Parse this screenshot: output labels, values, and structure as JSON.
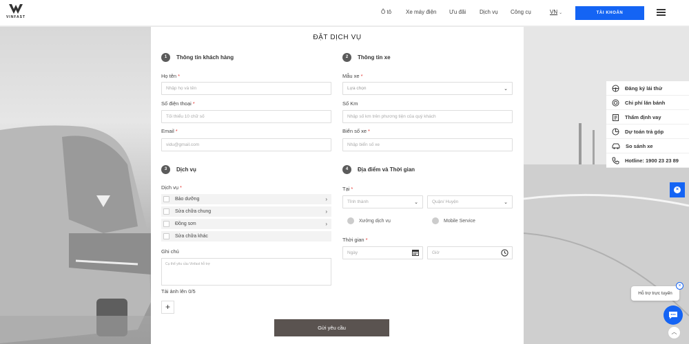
{
  "header": {
    "logo_text": "VINFAST",
    "nav": [
      "Ô tô",
      "Xe máy điện",
      "Ưu đãi",
      "Dịch vụ",
      "Công cụ"
    ],
    "lang": "VN",
    "account_label": "TÀI KHOẢN"
  },
  "form": {
    "title": "ĐẶT DỊCH VỤ",
    "customer": {
      "num": "1",
      "heading": "Thông tin khách hàng",
      "name_label": "Họ tên",
      "name_placeholder": "Nhập họ và tên",
      "phone_label": "Số điện thoại",
      "phone_placeholder": "Tối thiểu 10 chữ số",
      "email_label": "Email",
      "email_placeholder": "vidu@gmail.com"
    },
    "vehicle": {
      "num": "2",
      "heading": "Thông tin xe",
      "model_label": "Mẫu xe",
      "model_value": "Lựa chọn",
      "km_label": "Số Km",
      "km_placeholder": "Nhập số km trên phương tiện của quý khách",
      "plate_label": "Biển số xe",
      "plate_placeholder": "Nhập biển số xe"
    },
    "service": {
      "num": "3",
      "heading": "Dịch vụ",
      "label": "Dịch vụ",
      "options": [
        "Bảo dưỡng",
        "Sửa chữa chung",
        "Đồng sơn",
        "Sửa chữa khác"
      ],
      "note_label": "Ghi chú",
      "note_placeholder": "Cụ thể yêu cầu Vinfast hỗ trợ",
      "upload_label": "Tải ảnh lên 0/5",
      "add_symbol": "+"
    },
    "location": {
      "num": "4",
      "heading": "Địa điểm và Thời gian",
      "at_label": "Tại",
      "province_placeholder": "Tỉnh thành",
      "district_placeholder": "Quận/ Huyện",
      "radio_workshop": "Xưởng dịch vụ",
      "radio_mobile": "Mobile Service",
      "time_label": "Thời gian",
      "date_placeholder": "Ngày",
      "hour_placeholder": "Giờ"
    },
    "submit_label": "Gửi yêu cầu"
  },
  "quick_links": [
    {
      "label": "Đăng ký lái thử",
      "icon": "steering-wheel-icon"
    },
    {
      "label": "Chi phí lăn bánh",
      "icon": "coins-icon"
    },
    {
      "label": "Thẩm định vay",
      "icon": "clipboard-icon"
    },
    {
      "label": "Dự toán trả góp",
      "icon": "calculator-icon"
    },
    {
      "label": "So sánh xe",
      "icon": "car-icon"
    },
    {
      "label": "Hotline: 1900 23 23 89",
      "icon": "phone-icon"
    }
  ],
  "chat": {
    "bubble_text": "Hỗ trợ trực tuyến"
  },
  "colors": {
    "accent": "#1464f4",
    "submit": "#5a5350",
    "required": "#e53935"
  }
}
